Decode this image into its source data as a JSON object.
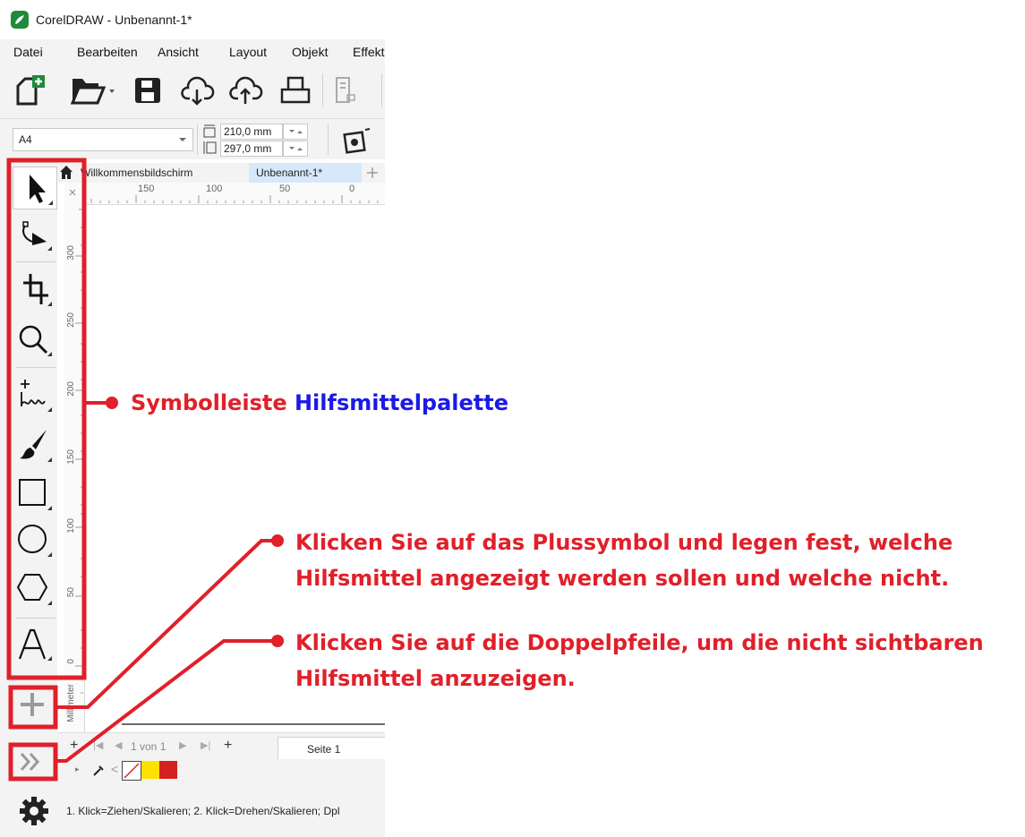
{
  "window": {
    "title": "CorelDRAW - Unbenannt-1*"
  },
  "menu": [
    "Datei",
    "Bearbeiten",
    "Ansicht",
    "Layout",
    "Objekt",
    "Effekt"
  ],
  "properties": {
    "page_size": "A4",
    "width": "210,0 mm",
    "height": "297,0 mm"
  },
  "tabs": {
    "welcome": "Willkommensbildschirm",
    "document": "Unbenannt-1*"
  },
  "ruler": {
    "h_ticks": [
      "150",
      "100",
      "50",
      "0"
    ],
    "v_ticks": [
      "300",
      "250",
      "200",
      "150",
      "100",
      "50",
      "0"
    ],
    "unit": "Millimeter"
  },
  "toolbox": {
    "tools": [
      "pick-tool-icon",
      "shape-tool-icon",
      "crop-tool-icon",
      "zoom-tool-icon",
      "freehand-tool-icon",
      "artistic-media-icon",
      "rectangle-tool-icon",
      "ellipse-tool-icon",
      "polygon-tool-icon",
      "text-tool-icon"
    ],
    "customize_icon": "plus-icon",
    "expand_icon": "double-chevron-icon"
  },
  "pagebar": {
    "page_counter": "1 von 1",
    "page_tab": "Seite 1"
  },
  "palette": {
    "swatches": [
      "#ffe000",
      "#d52020"
    ]
  },
  "status": {
    "text": "1. Klick=Ziehen/Skalieren; 2. Klick=Drehen/Skalieren; Dpl"
  },
  "annotations": {
    "toolbar_label_red": "Symbolleiste",
    "toolbar_label_blue": "Hilfsmittelpalette",
    "plus_line1": "Klicken Sie auf das Plussymbol und legen fest, welche",
    "plus_line2": "Hilfsmittel angezeigt werden sollen und welche nicht.",
    "arrows_line1": "Klicken Sie auf die Doppelpfeile, um die nicht sichtbaren",
    "arrows_line2": "Hilfsmittel anzuzeigen."
  },
  "colors": {
    "annotation_red": "#e0202a",
    "annotation_blue": "#1a1ae6",
    "accent": "#1e8a3a"
  }
}
